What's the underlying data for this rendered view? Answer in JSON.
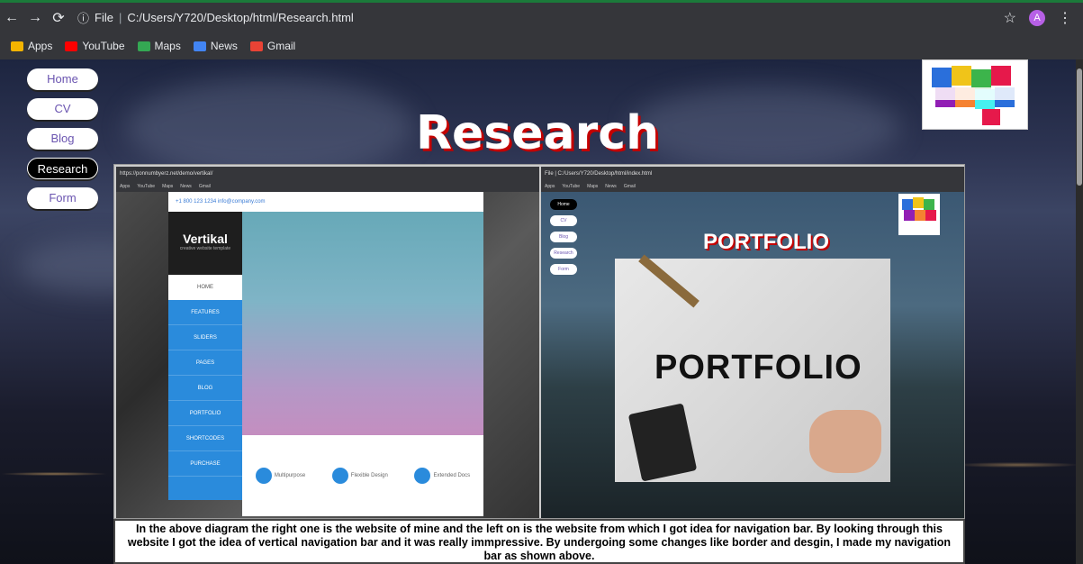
{
  "browser": {
    "url_prefix": "File",
    "url": "C:/Users/Y720/Desktop/html/Research.html",
    "avatar_letter": "A",
    "bookmarks": [
      {
        "label": "Apps",
        "color": "#f4b400"
      },
      {
        "label": "YouTube",
        "color": "#ff0000"
      },
      {
        "label": "Maps",
        "color": "#34a853"
      },
      {
        "label": "News",
        "color": "#4285f4"
      },
      {
        "label": "Gmail",
        "color": "#ea4335"
      }
    ]
  },
  "nav": {
    "items": [
      "Home",
      "CV",
      "Blog",
      "Research",
      "Form"
    ],
    "active": "Research"
  },
  "page": {
    "title": "Research",
    "caption": "In the above diagram the right one is the website of mine and the left on is the website from which I got idea for navigation bar. By looking through this website I got the idea of vertical navigation bar and it was really immpressive. By undergoing some changes like border and desgin, I made my navigation bar as shown above."
  },
  "left_shot": {
    "url": "https://ponnumbyerz.net/demo/vertikal/",
    "contact": "+1 800 123 1234   info@company.com",
    "brand": "Vertikal",
    "brand_sub": "creative website template",
    "menu": [
      "HOME",
      "FEATURES",
      "SLIDERS",
      "PAGES",
      "BLOG",
      "PORTFOLIO",
      "SHORTCODES",
      "PURCHASE"
    ],
    "features": [
      "Multipurpose",
      "Flexible Design",
      "Extended Docs"
    ]
  },
  "right_shot": {
    "url": "File | C:/Users/Y720/Desktop/html/index.html",
    "nav": [
      "Home",
      "CV",
      "Blog",
      "Research",
      "Form"
    ],
    "title": "PORTFOLIO",
    "photo_text": "PORTFOLIO"
  },
  "colors": {
    "title_shadow": "#c40000",
    "nav_text": "#6a54b0",
    "left_nav_blue": "#2a8bdc"
  }
}
